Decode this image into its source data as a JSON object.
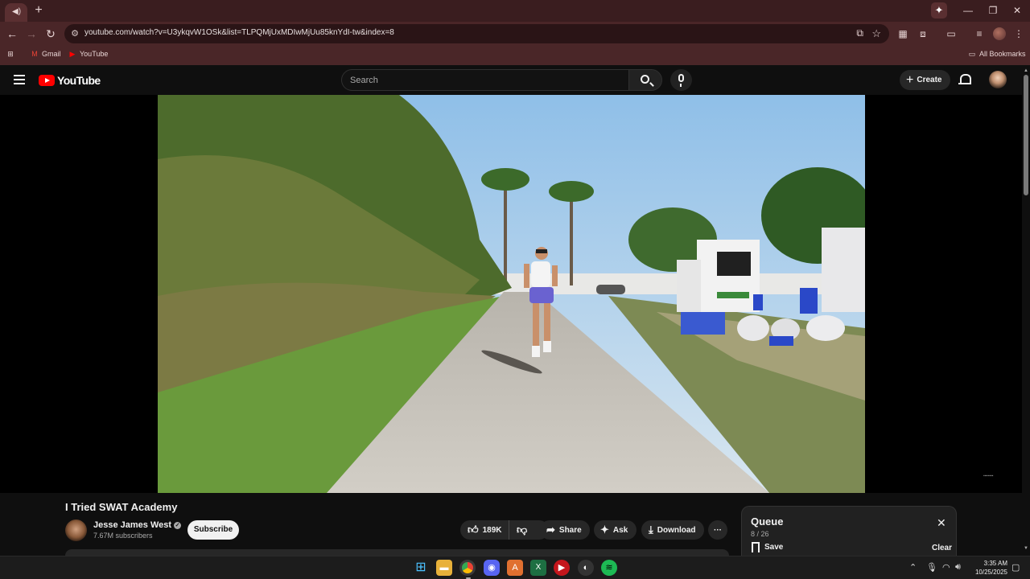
{
  "browser": {
    "tab_icon": "speaker-icon",
    "new_tab": "+",
    "url": "youtube.com/watch?v=U3ykqvW1OSk&list=TLPQMjUxMDIwMjUu85knYdI-tw&index=8",
    "bookmarks": [
      {
        "label": "Gmail",
        "icon": "gmail-icon",
        "color": "#ea4335"
      },
      {
        "label": "YouTube",
        "icon": "youtube-icon",
        "color": "#ff0000"
      }
    ],
    "all_bookmarks": "All Bookmarks"
  },
  "youtube": {
    "logo_text": "YouTube",
    "search_placeholder": "Search",
    "create_label": "Create",
    "create_symbol": "+"
  },
  "video": {
    "title": "I Tried SWAT Academy",
    "channel": "Jesse James West",
    "verified_mark": "✓",
    "subscribers": "7.67M subscribers",
    "subscribe_label": "Subscribe",
    "likes": "189K",
    "share_label": "Share",
    "ask_label": "Ask",
    "download_label": "Download",
    "more_label": "···"
  },
  "queue": {
    "title": "Queue",
    "count": "8 / 26",
    "save_label": "Save",
    "clear_label": "Clear",
    "close_symbol": "✕"
  },
  "taskbar": {
    "time": "3:35 AM",
    "date": "10/25/2025"
  },
  "colors": {
    "accent_red": "#ff0000",
    "browser_frame": "#4a2628",
    "page_bg": "#0f0f0f"
  }
}
